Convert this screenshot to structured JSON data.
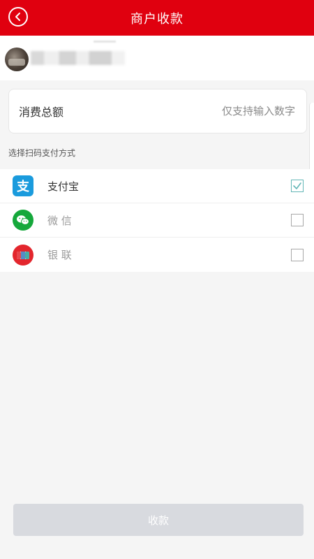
{
  "header": {
    "title": "商户收款"
  },
  "amount": {
    "label": "消费总额",
    "placeholder": "仅支持输入数字",
    "value": ""
  },
  "payment": {
    "section_label": "选择扫码支付方式",
    "options": [
      {
        "label": "支付宝",
        "icon": "alipay-icon",
        "checked": true,
        "color": "#1a9bdd"
      },
      {
        "label": "微 信",
        "icon": "wechat-icon",
        "checked": false,
        "color": "#15a83b"
      },
      {
        "label": "银 联",
        "icon": "unionpay-icon",
        "checked": false,
        "color": "#e3262d"
      }
    ]
  },
  "submit": {
    "label": "收款"
  },
  "colors": {
    "brand": "#e0000f",
    "check": "#63b6b6",
    "button_disabled": "#d8dadf"
  }
}
